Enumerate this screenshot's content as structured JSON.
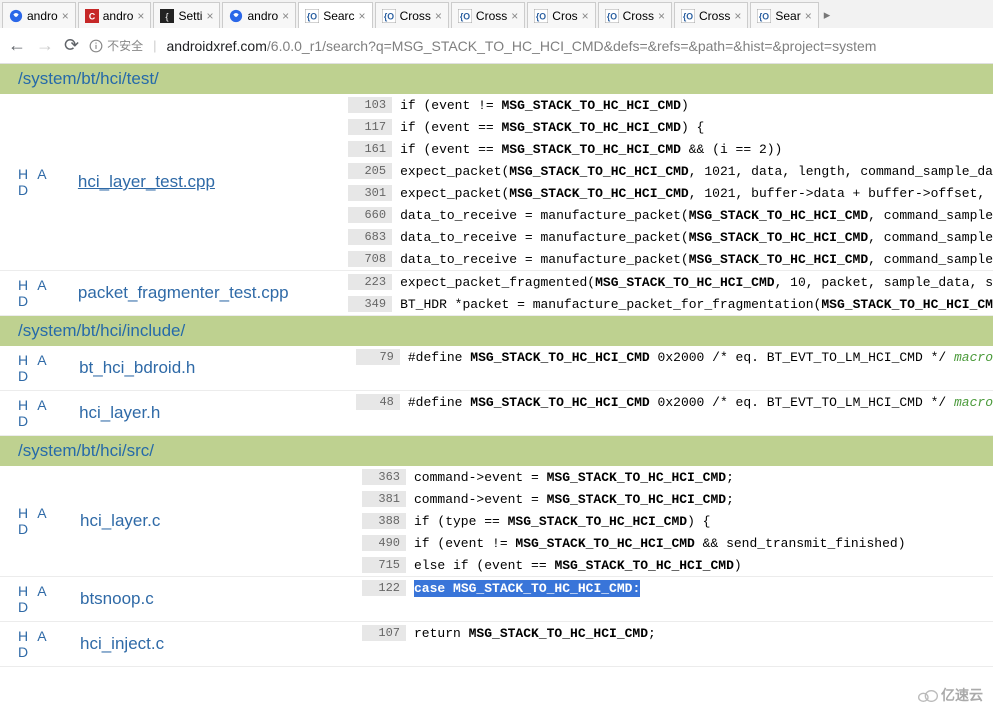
{
  "tabs": [
    {
      "label": "andro",
      "icon": "baidu"
    },
    {
      "label": "andro",
      "icon": "csdn"
    },
    {
      "label": "Setti",
      "icon": "brace"
    },
    {
      "label": "andro",
      "icon": "baidu"
    },
    {
      "label": "Searc",
      "icon": "xref",
      "active": true
    },
    {
      "label": "Cross",
      "icon": "xref"
    },
    {
      "label": "Cross",
      "icon": "xref"
    },
    {
      "label": "Cros",
      "icon": "xref"
    },
    {
      "label": "Cross",
      "icon": "xref"
    },
    {
      "label": "Cross",
      "icon": "xref"
    },
    {
      "label": "Sear",
      "icon": "xref"
    }
  ],
  "address": {
    "insecure": "不安全",
    "host": "androidxref.com",
    "path": "/6.0.0_r1/search?q=MSG_STACK_TO_HC_HCI_CMD&defs=&refs=&path=&hist=&project=system"
  },
  "dirs": [
    {
      "path": "/system/bt/hci/test/",
      "files": [
        {
          "name": "hci_layer_test.cpp",
          "underline": true,
          "had": "H A D",
          "lines": [
            {
              "n": "103",
              "pre": "if (event != ",
              "bold": "MSG_STACK_TO_HC_HCI_CMD",
              "post": ")"
            },
            {
              "n": "117",
              "pre": "if (event == ",
              "bold": "MSG_STACK_TO_HC_HCI_CMD",
              "post": ") {"
            },
            {
              "n": "161",
              "pre": "if (event == ",
              "bold": "MSG_STACK_TO_HC_HCI_CMD",
              "post": " && (i == 2))"
            },
            {
              "n": "205",
              "pre": "expect_packet(",
              "bold": "MSG_STACK_TO_HC_HCI_CMD",
              "post": ", 1021, data, length, command_sample_da"
            },
            {
              "n": "301",
              "pre": "expect_packet(",
              "bold": "MSG_STACK_TO_HC_HCI_CMD",
              "post": ", 1021, buffer->data + buffer->offset, "
            },
            {
              "n": "660",
              "pre": "data_to_receive = manufacture_packet(",
              "bold": "MSG_STACK_TO_HC_HCI_CMD",
              "post": ", command_sample"
            },
            {
              "n": "683",
              "pre": "data_to_receive = manufacture_packet(",
              "bold": "MSG_STACK_TO_HC_HCI_CMD",
              "post": ", command_sample"
            },
            {
              "n": "708",
              "pre": "data_to_receive = manufacture_packet(",
              "bold": "MSG_STACK_TO_HC_HCI_CMD",
              "post": ", command_sample"
            }
          ]
        },
        {
          "name": "packet_fragmenter_test.cpp",
          "had": "H A D",
          "lines": [
            {
              "n": "223",
              "pre": "expect_packet_fragmented(",
              "bold": "MSG_STACK_TO_HC_HCI_CMD",
              "post": ", 10, packet, sample_data, s"
            },
            {
              "n": "349",
              "pre": "BT_HDR *packet = manufacture_packet_for_fragmentation(",
              "bold": "MSG_STACK_TO_HC_HCI_CM",
              "post": ""
            }
          ]
        }
      ]
    },
    {
      "path": "/system/bt/hci/include/",
      "files": [
        {
          "name": "bt_hci_bdroid.h",
          "had": "H A D",
          "lines": [
            {
              "n": "79",
              "pre": "#define ",
              "bold": "MSG_STACK_TO_HC_HCI_CMD",
              "post": " 0x2000 /* eq. BT_EVT_TO_LM_HCI_CMD */  ",
              "macro": "macro"
            }
          ]
        },
        {
          "name": "hci_layer.h",
          "had": "H A D",
          "lines": [
            {
              "n": "48",
              "pre": "#define ",
              "bold": "MSG_STACK_TO_HC_HCI_CMD",
              "post": " 0x2000 /* eq. BT_EVT_TO_LM_HCI_CMD */  ",
              "macro": "macro"
            }
          ]
        }
      ]
    },
    {
      "path": "/system/bt/hci/src/",
      "files": [
        {
          "name": "hci_layer.c",
          "had": "H A D",
          "lines": [
            {
              "n": "363",
              "pre": "command->event = ",
              "bold": "MSG_STACK_TO_HC_HCI_CMD",
              "post": ";"
            },
            {
              "n": "381",
              "pre": "command->event = ",
              "bold": "MSG_STACK_TO_HC_HCI_CMD",
              "post": ";"
            },
            {
              "n": "388",
              "pre": "if (type == ",
              "bold": "MSG_STACK_TO_HC_HCI_CMD",
              "post": ") {"
            },
            {
              "n": "490",
              "pre": "if (event != ",
              "bold": "MSG_STACK_TO_HC_HCI_CMD",
              "post": " && send_transmit_finished)"
            },
            {
              "n": "715",
              "pre": "else if (event == ",
              "bold": "MSG_STACK_TO_HC_HCI_CMD",
              "post": ")"
            }
          ]
        },
        {
          "name": "btsnoop.c",
          "had": "H A D",
          "lines": [
            {
              "n": "122",
              "hl_pre": "case ",
              "hl_bold": "MSG_STACK_TO_HC_HCI_CMD",
              "hl_post": ":"
            }
          ]
        },
        {
          "name": "hci_inject.c",
          "had": "H A D",
          "lines": [
            {
              "n": "107",
              "pre": "return ",
              "bold": "MSG_STACK_TO_HC_HCI_CMD",
              "post": ";"
            }
          ]
        }
      ]
    }
  ],
  "watermark": "亿速云"
}
